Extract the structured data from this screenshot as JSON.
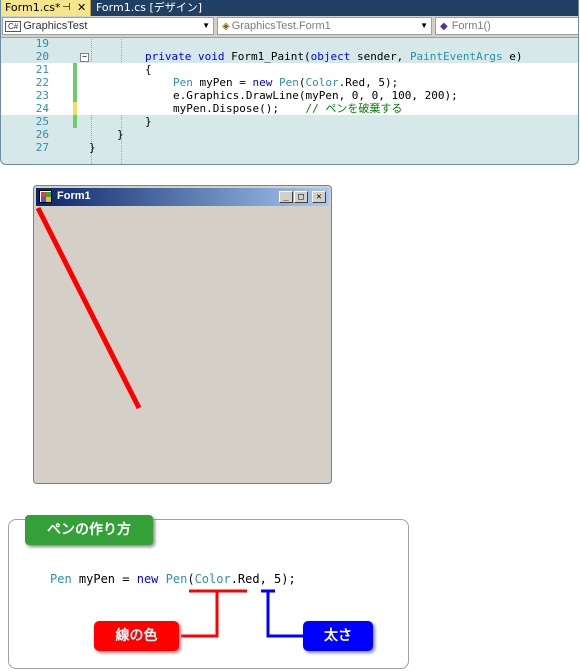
{
  "editor": {
    "tabs": [
      {
        "label": "Form1.cs*",
        "pin": "⊣",
        "close": "✕"
      },
      {
        "label": "Form1.cs [デザイン]"
      }
    ],
    "combos": {
      "project": {
        "icon": "C#",
        "text": "GraphicsTest"
      },
      "class": {
        "text": "GraphicsTest.Form1"
      },
      "member": {
        "text": "Form1()"
      }
    },
    "lines": [
      {
        "n": "19"
      },
      {
        "n": "20"
      },
      {
        "n": "21"
      },
      {
        "n": "22"
      },
      {
        "n": "23"
      },
      {
        "n": "24"
      },
      {
        "n": "25"
      },
      {
        "n": "26"
      },
      {
        "n": "27"
      }
    ],
    "code": {
      "l20_a": "private void ",
      "l20_b": "Form1_Paint(",
      "l20_c": "object",
      "l20_d": " sender, ",
      "l20_e": "PaintEventArgs",
      "l20_f": " e)",
      "l21": "{",
      "l22_a": "Pen",
      "l22_b": " myPen = ",
      "l22_c": "new",
      "l22_d": " ",
      "l22_e": "Pen",
      "l22_f": "(",
      "l22_g": "Color",
      "l22_h": ".Red, 5);",
      "l23": "e.Graphics.DrawLine(myPen, 0, 0, 100, 200);",
      "l24_a": "myPen.Dispose();    ",
      "l24_b": "// ペンを破棄する",
      "l25": "}",
      "l26": "}",
      "l27": "}"
    }
  },
  "form": {
    "title": "Form1",
    "buttons": {
      "min": "_",
      "max": "□",
      "close": "✕"
    },
    "line_color": "#ff0000"
  },
  "panel": {
    "heading": "ペンの作り方",
    "code": {
      "a": "Pen",
      "b": " myPen = ",
      "c": "new",
      "d": " ",
      "e": "Pen",
      "f": "(",
      "g": "Color",
      "h": ".Red, 5);"
    },
    "color_label": "線の色",
    "width_label": "太さ",
    "colors": {
      "heading": "#33a137",
      "color_badge": "#ff0000",
      "width_badge": "#0000ff"
    }
  }
}
